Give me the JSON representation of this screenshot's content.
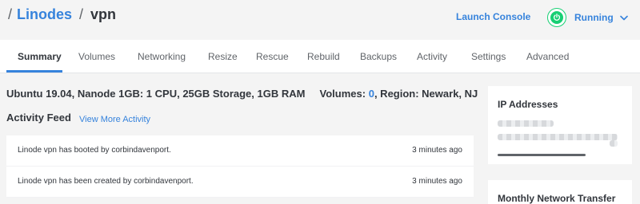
{
  "breadcrumb": {
    "separator": "/",
    "parent_label": "Linodes",
    "current_label": "vpn"
  },
  "header_actions": {
    "launch_console_label": "Launch Console",
    "status_label": "Running",
    "status_color": "#17cf73"
  },
  "tabs": [
    {
      "label": "Summary",
      "active": true
    },
    {
      "label": "Volumes"
    },
    {
      "label": "Networking"
    },
    {
      "label": "Resize"
    },
    {
      "label": "Rescue"
    },
    {
      "label": "Rebuild"
    },
    {
      "label": "Backups"
    },
    {
      "label": "Activity"
    },
    {
      "label": "Settings"
    },
    {
      "label": "Advanced"
    }
  ],
  "summary": {
    "specs": "Ubuntu 19.04, Nanode 1GB: 1 CPU, 25GB Storage, 1GB RAM",
    "volumes_label": "Volumes:",
    "volumes_count": "0",
    "region_text": ", Region: Newark, NJ"
  },
  "activity": {
    "title": "Activity Feed",
    "view_more_label": "View More Activity",
    "items": [
      {
        "message": "Linode vpn has booted by corbindavenport.",
        "time": "3 minutes ago"
      },
      {
        "message": "Linode vpn has been created by corbindavenport.",
        "time": "3 minutes ago"
      }
    ]
  },
  "sidebar": {
    "ip_title": "IP Addresses",
    "transfer_title": "Monthly Network Transfer"
  },
  "colors": {
    "accent": "#3683dc",
    "background": "#f4f4f4",
    "text": "#32363c"
  }
}
